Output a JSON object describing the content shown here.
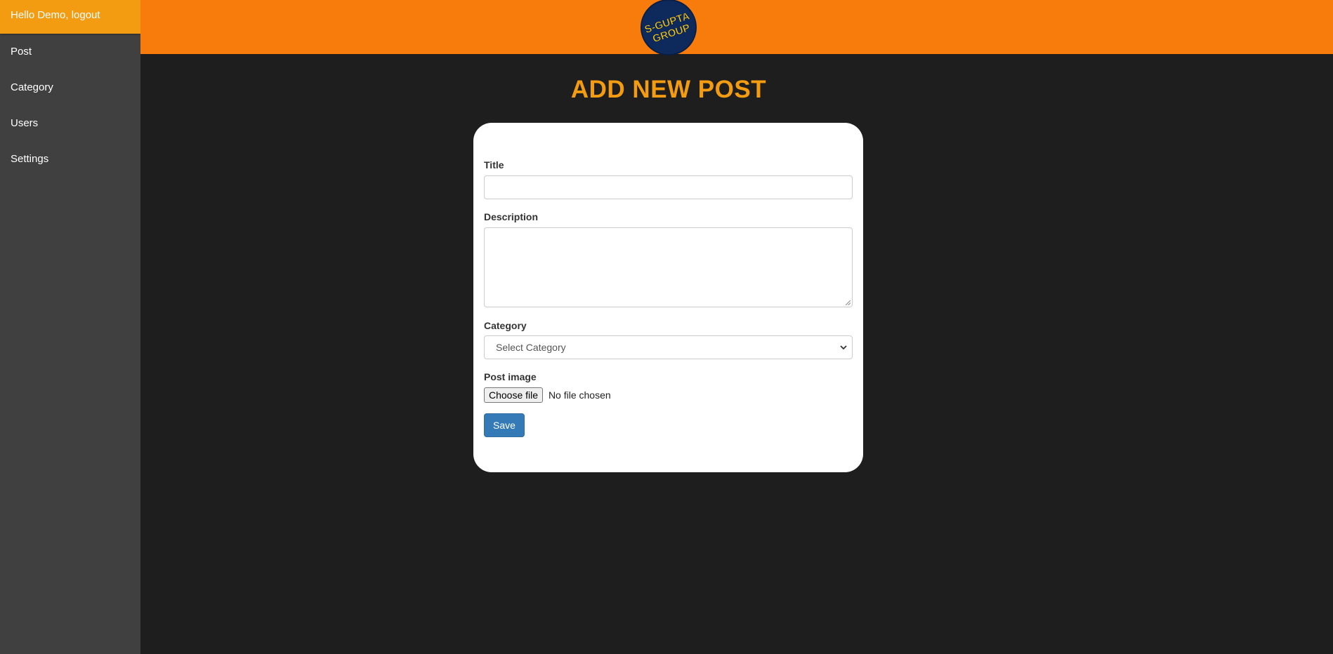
{
  "sidebar": {
    "greeting": "Hello Demo, logout",
    "items": [
      {
        "label": "Post"
      },
      {
        "label": "Category"
      },
      {
        "label": "Users"
      },
      {
        "label": "Settings"
      }
    ]
  },
  "header": {
    "logo_text": [
      "S-GUPTA",
      "GROUP"
    ],
    "logo_icon": "brand-logo"
  },
  "page": {
    "title": "ADD NEW POST"
  },
  "form": {
    "title_label": "Title",
    "title_value": "",
    "description_label": "Description",
    "description_value": "",
    "category_label": "Category",
    "category_selected": "Select Category",
    "image_label": "Post image",
    "file_button_label": "Choose file",
    "file_status": "No file chosen",
    "save_label": "Save"
  },
  "colors": {
    "accent_orange": "#f39c12",
    "header_orange": "#f87c0c",
    "sidebar_bg": "#404040",
    "main_bg": "#1e1e1e",
    "button_blue": "#337ab7",
    "logo_navy": "#0e2a5c",
    "logo_yellow": "#f5c518"
  }
}
